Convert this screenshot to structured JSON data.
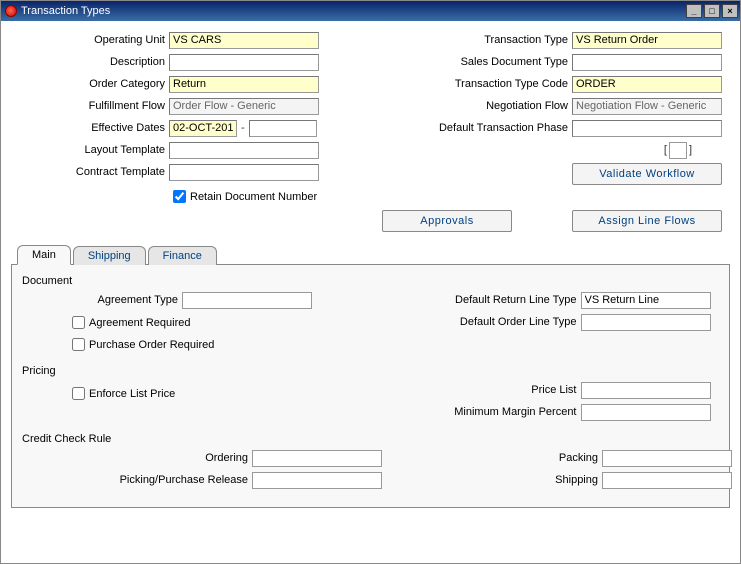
{
  "window": {
    "title": "Transaction Types"
  },
  "winbtns": {
    "min": "_",
    "max": "□",
    "close": "×"
  },
  "left": {
    "operating_unit_l": "Operating Unit",
    "operating_unit_v": "VS CARS",
    "description_l": "Description",
    "description_v": "",
    "order_category_l": "Order Category",
    "order_category_v": "Return",
    "fulfillment_flow_l": "Fulfillment Flow",
    "fulfillment_flow_v": "Order Flow - Generic",
    "effective_dates_l": "Effective Dates",
    "eff_from": "02-OCT-201",
    "eff_to": "",
    "layout_template_l": "Layout Template",
    "layout_template_v": "",
    "contract_template_l": "Contract Template",
    "contract_template_v": "",
    "retain_l": "Retain Document Number"
  },
  "right": {
    "transaction_type_l": "Transaction Type",
    "transaction_type_v": "VS Return Order",
    "sales_doc_type_l": "Sales Document Type",
    "sales_doc_type_v": "",
    "tx_type_code_l": "Transaction Type Code",
    "tx_type_code_v": "ORDER",
    "negotiation_flow_l": "Negotiation Flow",
    "negotiation_flow_v": "Negotiation Flow - Generic",
    "default_tx_phase_l": "Default Transaction Phase",
    "default_tx_phase_v": ""
  },
  "buttons": {
    "validate": "Validate Workflow",
    "approvals": "Approvals",
    "assign": "Assign Line  Flows"
  },
  "tabs": {
    "main": "Main",
    "shipping": "Shipping",
    "finance": "Finance"
  },
  "main": {
    "document_section": "Document",
    "agreement_type_l": "Agreement Type",
    "agreement_type_v": "",
    "agreement_required_l": "Agreement Required",
    "po_required_l": "Purchase Order Required",
    "def_return_line_l": "Default Return Line Type",
    "def_return_line_v": "VS Return Line",
    "def_order_line_l": "Default Order Line Type",
    "def_order_line_v": "",
    "pricing_section": "Pricing",
    "enforce_list_l": "Enforce List Price",
    "price_list_l": "Price List",
    "price_list_v": "",
    "min_margin_l": "Minimum Margin Percent",
    "min_margin_v": "",
    "credit_section": "Credit Check Rule",
    "ordering_l": "Ordering",
    "ordering_v": "",
    "packing_l": "Packing",
    "packing_v": "",
    "pick_release_l": "Picking/Purchase Release",
    "pick_release_v": "",
    "shipping_l": "Shipping",
    "shipping_v": ""
  }
}
